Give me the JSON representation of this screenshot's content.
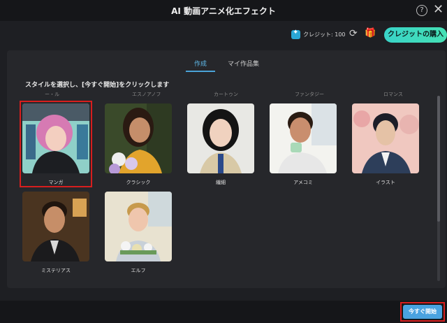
{
  "window": {
    "title": "AI 動画アニメ化エフェクト",
    "help_glyph": "?",
    "close_glyph": "✕"
  },
  "toolbar": {
    "credits_label": "クレジット: 100",
    "buy_button": "クレジットの購入"
  },
  "tabs": [
    {
      "label": "作成",
      "active": true
    },
    {
      "label": "マイ作品集",
      "active": false
    }
  ],
  "instruction": "スタイルを選択し、[今すぐ開始]をクリックします",
  "styles": [
    {
      "label": "マンガ",
      "selected": true
    },
    {
      "label": "クラシック",
      "selected": false
    },
    {
      "label": "繊細",
      "selected": false
    },
    {
      "label": "アメコミ",
      "selected": false
    },
    {
      "label": "イラスト",
      "selected": false
    },
    {
      "label": "ミステリアス",
      "selected": false
    },
    {
      "label": "エルフ",
      "selected": false
    }
  ],
  "footer": {
    "start_button": "今すぐ開始"
  },
  "colors": {
    "accent": "#4aa3e0",
    "buy": "#3fdcc0",
    "highlight": "#d71e1e"
  }
}
